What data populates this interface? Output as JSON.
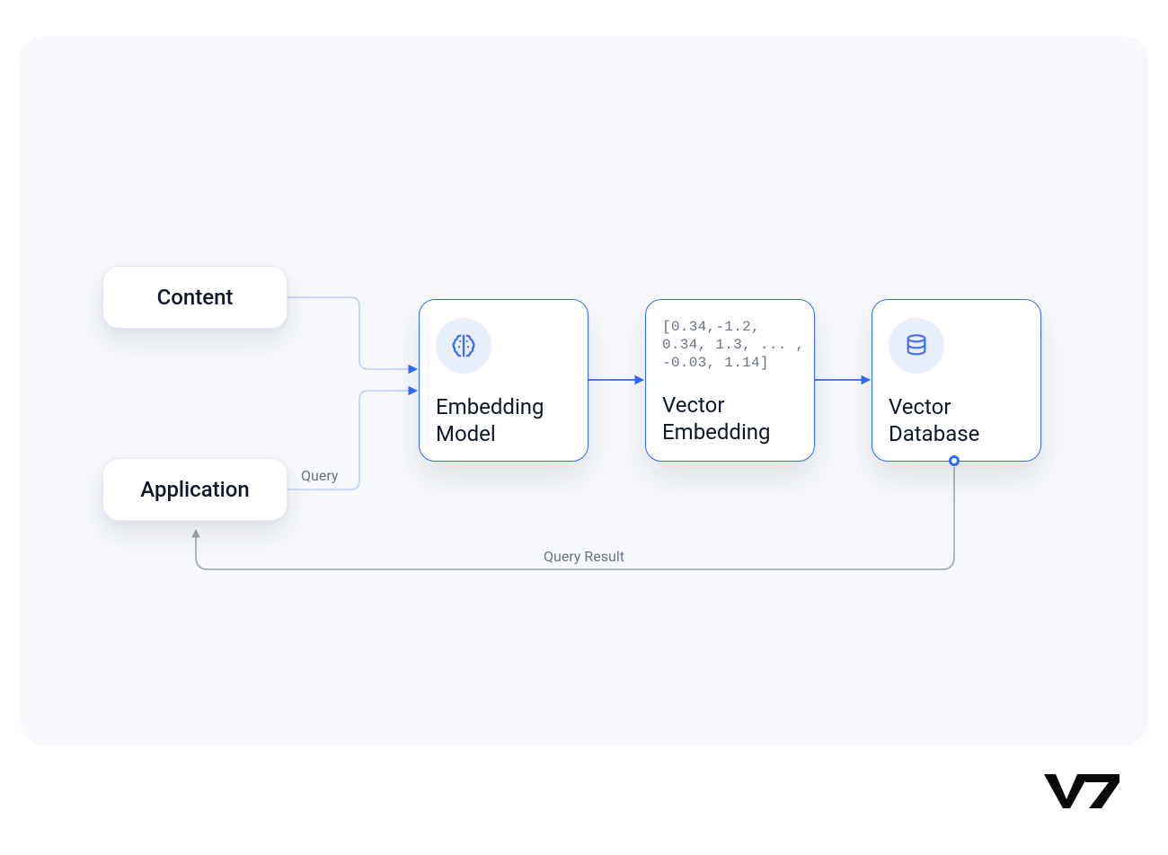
{
  "nodes": {
    "content": {
      "label": "Content"
    },
    "application": {
      "label": "Application"
    },
    "embedding_model": {
      "label": "Embedding\nModel",
      "icon": "brain-icon"
    },
    "vector_embedding": {
      "label": "Vector\nEmbedding",
      "sample": "[0.34,-1.2,\n0.34, 1.3, ... ,\n-0.03, 1.14]"
    },
    "vector_database": {
      "label": "Vector\nDatabase",
      "icon": "database-icon"
    }
  },
  "edges": {
    "query": {
      "label": "Query"
    },
    "query_result": {
      "label": "Query Result"
    }
  },
  "branding": {
    "logo_text": "V7"
  },
  "colors": {
    "panel_bg": "#f6f8fc",
    "node_border_accent": "#2f6bff",
    "node_border_soft": "#e5e9f2",
    "edge_soft": "#c3d4f7",
    "edge_strong": "#2f6bff",
    "edge_gray": "#9ca3af",
    "text_primary": "#0f172a",
    "text_muted": "#6b7280",
    "icon_circle": "#e7eefc"
  }
}
